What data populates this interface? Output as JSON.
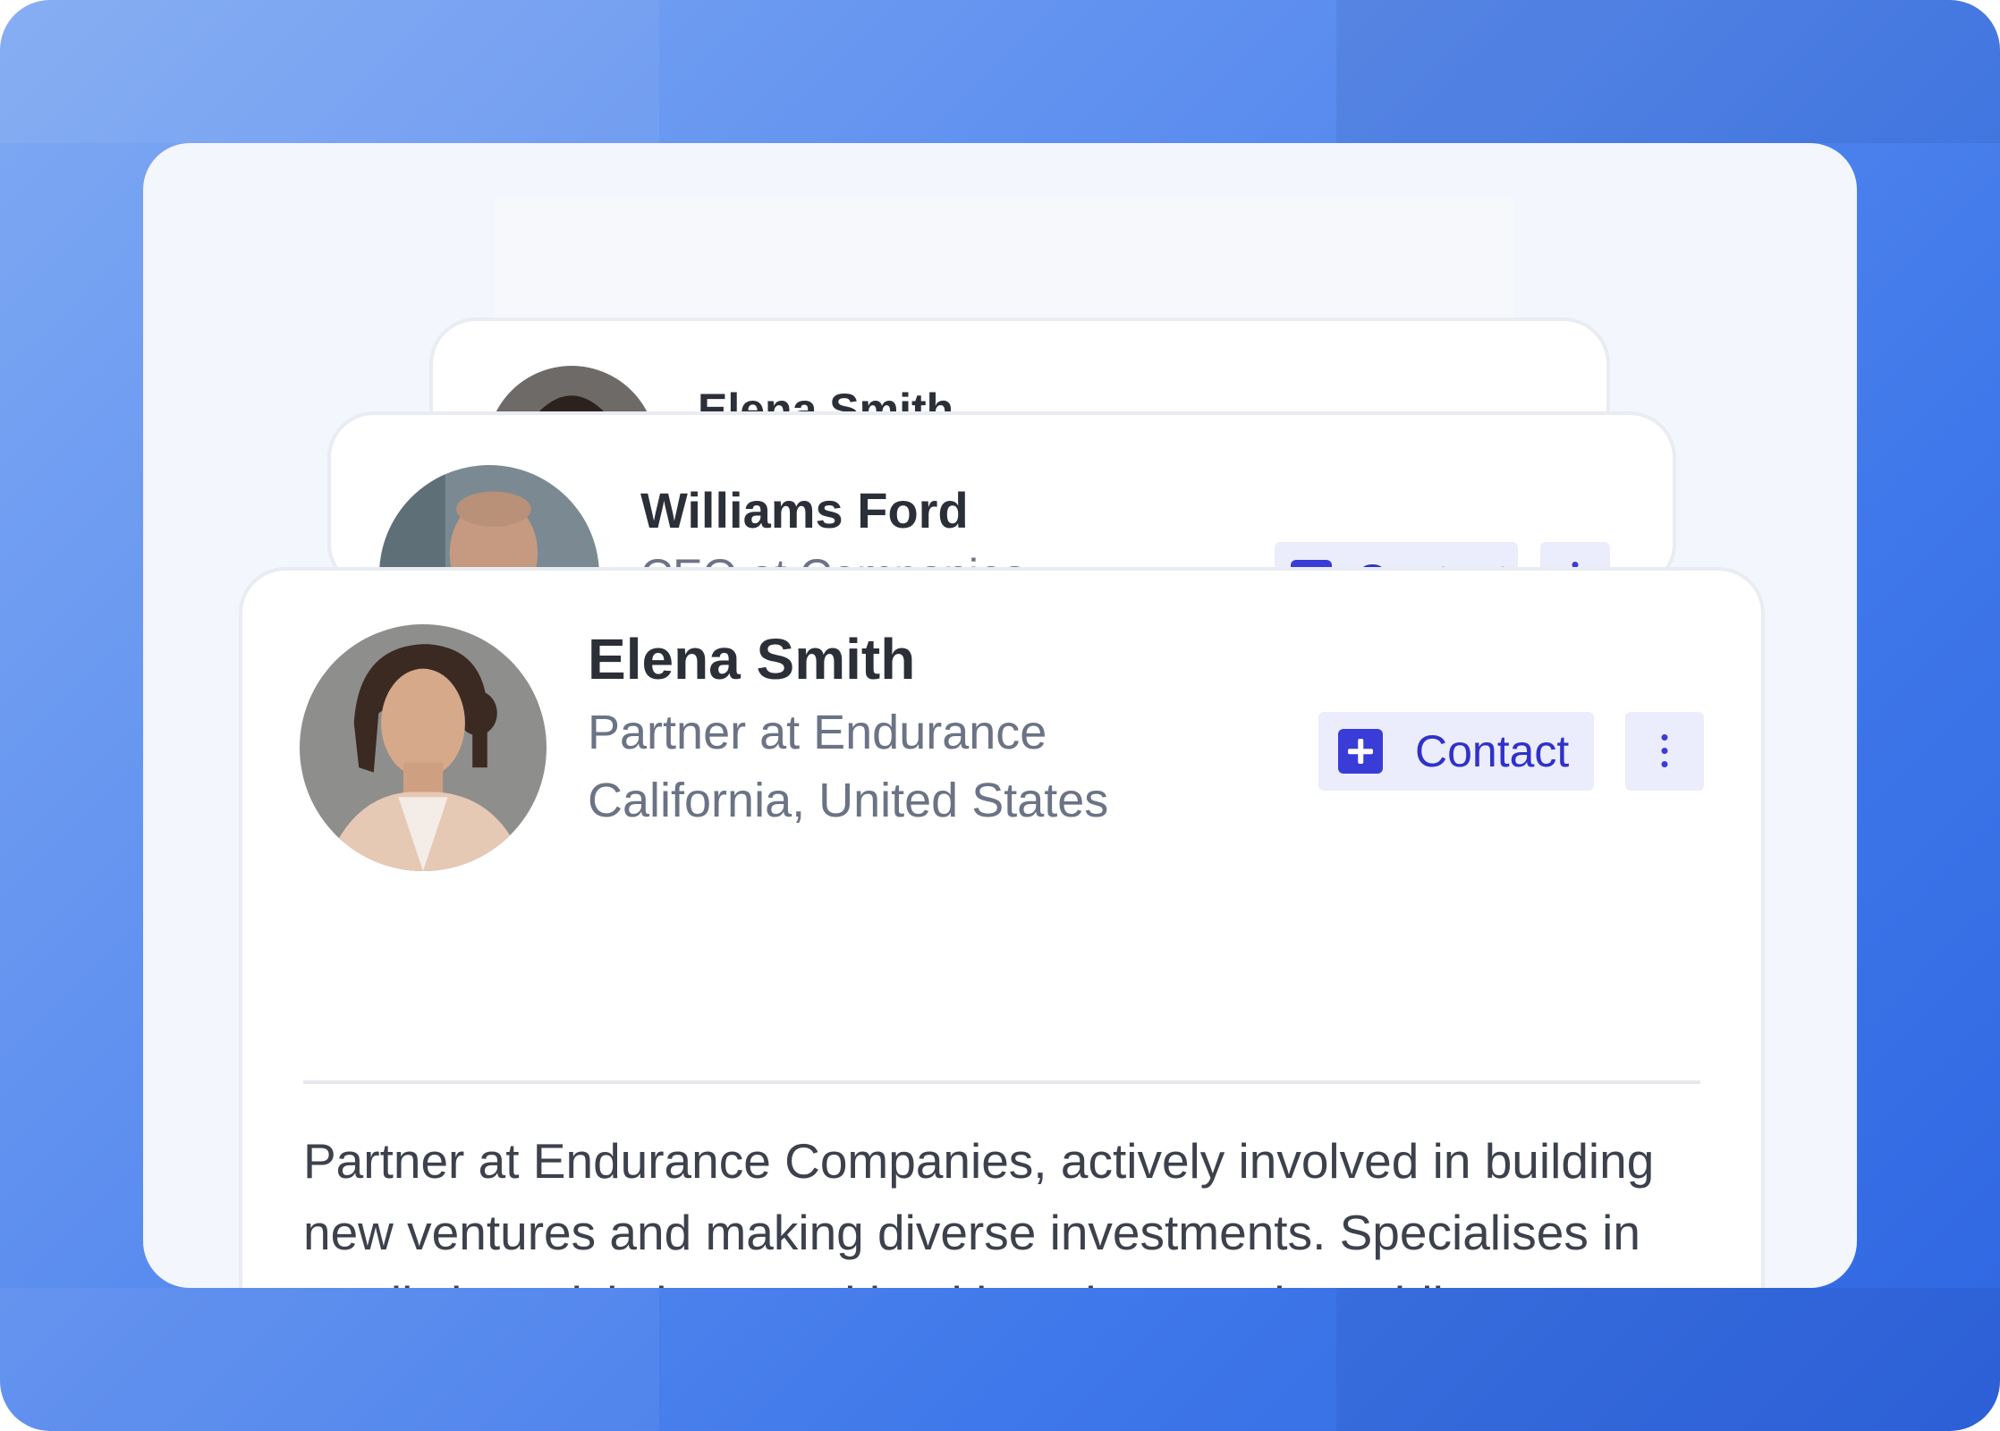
{
  "colors": {
    "background_blue": "#3f78ea",
    "panel": "#f3f6fd",
    "card": "#ffffff",
    "name_text": "#2b2f38",
    "muted_text": "#6b7385",
    "accent": "#3a3cd8",
    "accent_bg": "#ebedfd"
  },
  "cards": {
    "back2": {
      "name": "Elena Smith"
    },
    "back1": {
      "name": "Williams Ford",
      "subtitle": "CEO at Companies",
      "contact_label": "Contact"
    },
    "front": {
      "name": "Elena Smith",
      "title": "Partner at Endurance",
      "location": "California, United States",
      "contact_label": "Contact",
      "more_icon": "more-vertical-icon",
      "add_icon": "plus-square-icon",
      "bio": "Partner at Endurance Companies, actively involved in building new ventures and making diverse investments. Specialises in predicting crisis in mental health patients and providing stabilisation care"
    }
  }
}
